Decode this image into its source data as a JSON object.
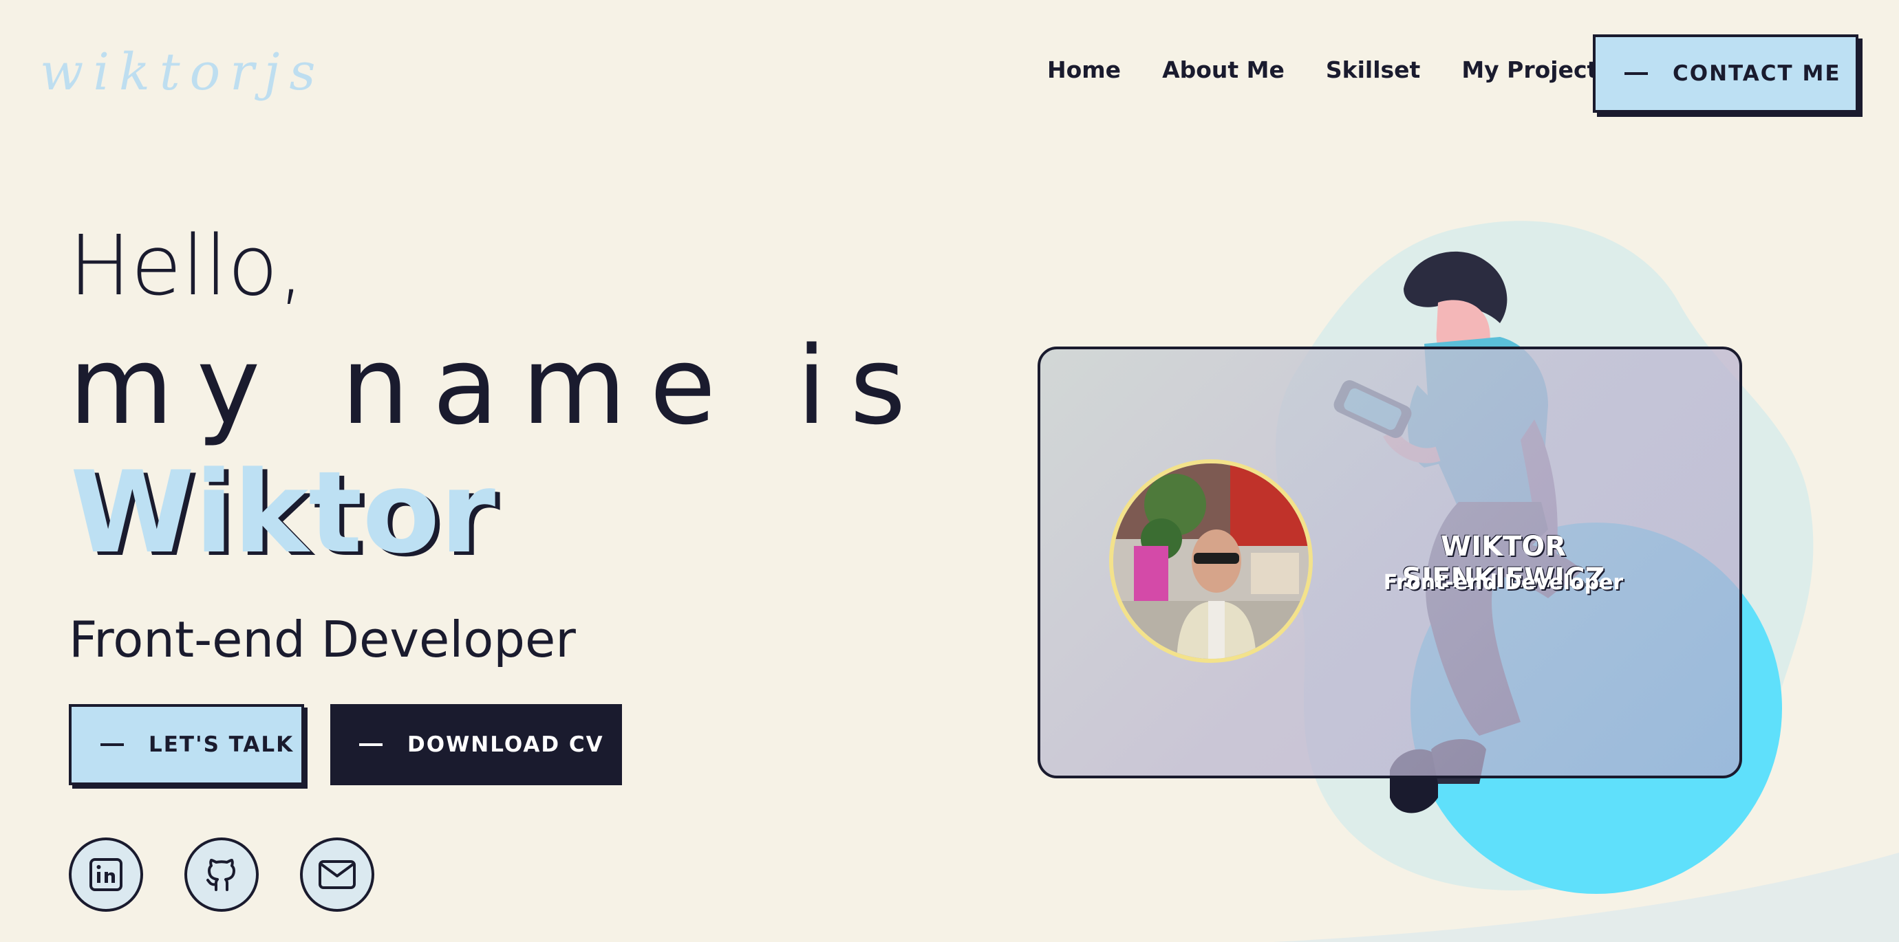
{
  "header": {
    "logo_text": "wiktorjs",
    "nav": [
      "Home",
      "About Me",
      "Skillset",
      "My Projects"
    ],
    "contact_label": "CONTACT ME"
  },
  "hero": {
    "hello": "Hello,",
    "my_name_is": "my name is",
    "name": "Wiktor",
    "role": "Front-end Developer",
    "talk_label": "LET'S TALK",
    "cv_label": "DOWNLOAD CV"
  },
  "social": {
    "icons": [
      "linkedin-icon",
      "github-icon",
      "mail-icon"
    ]
  },
  "card": {
    "full_name": "WIKTOR SIENKIEWICZ",
    "role": "Front-end Developer"
  },
  "colors": {
    "background": "#f6f2e6",
    "accent_light_blue": "#bde0f3",
    "dark_navy": "#1a1b2e",
    "cyan_blob": "#5fe0fb",
    "avatar_ring": "#f3e28b"
  }
}
